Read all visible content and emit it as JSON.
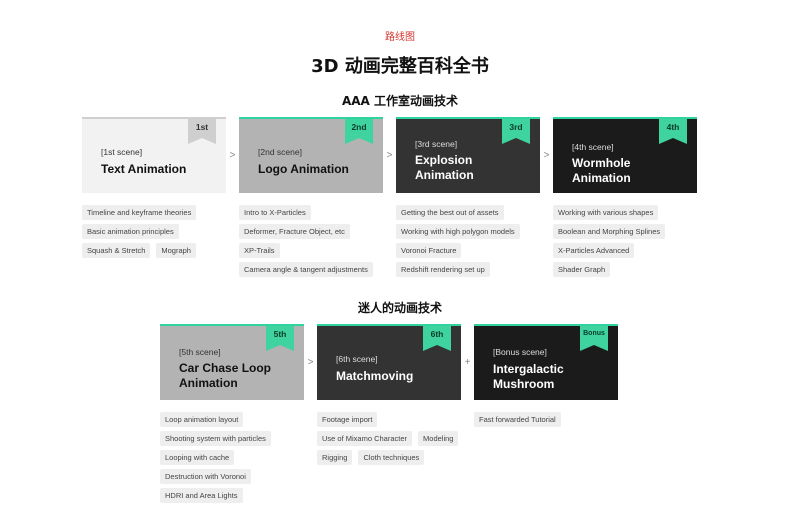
{
  "header": {
    "eyebrow": "路线图",
    "title": "3D 动画完整百科全书"
  },
  "sections": [
    {
      "heading": "AAA 工作室动画技术",
      "cards": [
        {
          "badge": "1st",
          "scene": "[1st scene]",
          "name": "Text Animation",
          "chips": [
            "Timeline and keyframe theories",
            "Basic animation principles",
            "Squash & Stretch",
            "Mograph"
          ]
        },
        {
          "badge": "2nd",
          "scene": "[2nd scene]",
          "name": "Logo Animation",
          "chips": [
            "Intro to X-Particles",
            "Deformer, Fracture Object, etc",
            "XP-Trails",
            "Camera angle & tangent adjustments"
          ]
        },
        {
          "badge": "3rd",
          "scene": "[3rd scene]",
          "name": "Explosion Animation",
          "chips": [
            "Getting the best out of assets",
            "Working with high polygon models",
            "Voronoi Fracture",
            "Redshift rendering set up"
          ]
        },
        {
          "badge": "4th",
          "scene": "[4th scene]",
          "name": "Wormhole Animation",
          "chips": [
            "Working with various shapes",
            "Boolean and Morphing Splines",
            "X-Particles Advanced",
            "Shader Graph"
          ]
        }
      ],
      "separators": [
        ">",
        ">",
        ">"
      ]
    },
    {
      "heading": "迷人的动画技术",
      "cards": [
        {
          "badge": "5th",
          "scene": "[5th scene]",
          "name": "Car Chase Loop Animation",
          "chips": [
            "Loop animation layout",
            "Shooting system with particles",
            "Looping with cache",
            "Destruction with Voronoi",
            "HDRI and Area Lights"
          ]
        },
        {
          "badge": "6th",
          "scene": "[6th scene]",
          "name": "Matchmoving",
          "chips": [
            "Footage import",
            "Use of Mixamo Character",
            "Modeling",
            "Rigging",
            "Cloth techniques"
          ]
        },
        {
          "badge": "Bonus",
          "scene": "[Bonus scene]",
          "name": "Intergalactic Mushroom",
          "chips": [
            "Fast forwarded Tutorial"
          ]
        }
      ],
      "separators": [
        ">",
        "+"
      ]
    }
  ],
  "colors": {
    "accent": "#3ed39f",
    "eyebrow": "#d0342c"
  }
}
